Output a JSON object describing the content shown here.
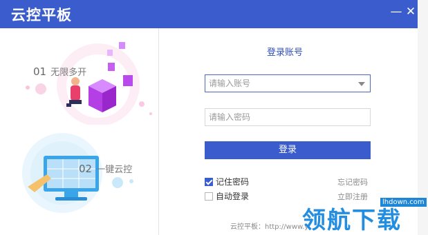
{
  "window": {
    "title": "云控平板",
    "minimize_icon": "minimize-icon",
    "close_icon": "close-icon"
  },
  "features": [
    {
      "number": "01",
      "label": "无限多开"
    },
    {
      "number": "02",
      "label": "一键云控"
    }
  ],
  "login": {
    "title": "登录账号",
    "account_placeholder": "请输入账号",
    "password_placeholder": "请输入密码",
    "submit_label": "登录",
    "remember_password": {
      "label": "记住密码",
      "checked": true
    },
    "auto_login": {
      "label": "自动登录",
      "checked": false
    },
    "forgot_password": "忘记密码",
    "register": "立即注册",
    "footer": "云控平板：http://www.y"
  },
  "watermark": {
    "domain": "lhdown.com",
    "text": "领航下载"
  },
  "colors": {
    "accent": "#3a5ccc",
    "watermark": "#238de0"
  }
}
